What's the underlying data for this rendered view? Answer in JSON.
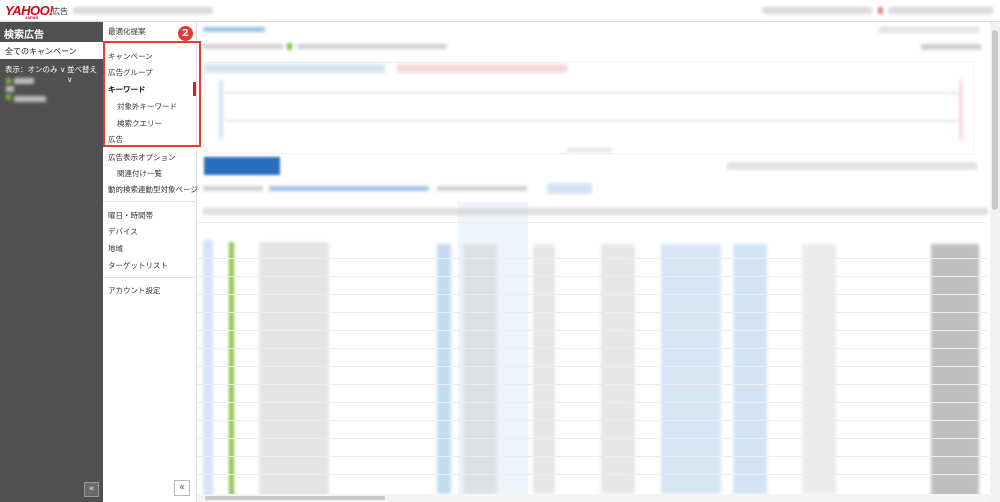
{
  "logo": {
    "text": "YAHOO!",
    "sub": "JAPAN",
    "product": "広告"
  },
  "sidebar": {
    "title": "検索広告",
    "all_campaigns": "全てのキャンペーン",
    "filter_label": "表示：オンのみ ∨",
    "sort_label": "並べ替え ∨",
    "collapse": "«"
  },
  "nav": {
    "items": [
      {
        "label": "最適化提案"
      },
      {
        "label": "キャンペーン"
      },
      {
        "label": "広告グループ"
      },
      {
        "label": "キーワード"
      },
      {
        "label": "対象外キーワード"
      },
      {
        "label": "検索クエリー"
      },
      {
        "label": "広告"
      },
      {
        "label": "広告表示オプション"
      },
      {
        "label": "関連付け一覧"
      },
      {
        "label": "動的検索連動型対象ページ"
      },
      {
        "label": "曜日・時間帯"
      },
      {
        "label": "デバイス"
      },
      {
        "label": "地域"
      },
      {
        "label": "ターゲットリスト"
      },
      {
        "label": "アカウント設定"
      }
    ],
    "active": "キーワード",
    "badge": "2",
    "collapse": "«"
  },
  "colors": {
    "highlight": "#e53935",
    "sidebar_bg": "#505050",
    "primary_button": "#2a6fbf"
  }
}
